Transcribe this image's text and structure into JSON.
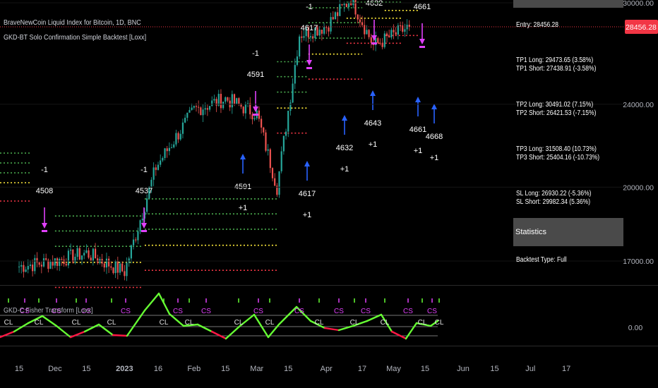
{
  "title": "BraveNewCoin Liquid Index for Bitcoin, 1D, BNC",
  "indicator_title": "GKD-BT Solo Confirmation Simple Backtest [Loxx]",
  "sub_indicator_title": "GKD-C Fisher Transform [Loxx]",
  "colors": {
    "background": "#000000",
    "up_candle": "#26a69a",
    "down_candle": "#ef5350",
    "long_arrow": "#2962ff",
    "short_arrow": "#e040fb",
    "tp_level": "#4caf50",
    "entry_level": "#ffeb3b",
    "sl_level": "#f23645",
    "price_line": "#f23645",
    "price_badge": "#f23645",
    "fisher_up": "#66ff33",
    "fisher_down": "#ff1744",
    "panel_header": "#4a4a4a"
  },
  "panel": {
    "entry": "Entry: 28456.28",
    "tp1_long": "TP1 Long: 29473.65 (3.58%)",
    "tp1_short": "TP1 Short: 27438.91 (-3.58%)",
    "tp2_long": "TP2 Long: 30491.02 (7.15%)",
    "tp2_short": "TP2 Short: 26421.53 (-7.15%)",
    "tp3_long": "TP3 Long: 31508.40 (10.73%)",
    "tp3_short": "TP3 Short: 25404.16 (-10.73%)",
    "sl_long": "SL Long: 26930.22 (-5.36%)",
    "sl_short": "SL Short: 29982.34 (5.36%)",
    "stats_header": "Statistics",
    "backtest_type": "Backtest Type: Full"
  },
  "chart_data": [
    {
      "type": "candlestick",
      "title": "BraveNewCoin Liquid Index for Bitcoin, 1D, BNC",
      "price_scale": "log",
      "y_ticks": [
        "17000.00",
        "20000.00",
        "24000.00",
        "30000.00"
      ],
      "last_price": "28456.28",
      "x_ticks": [
        "15",
        "Dec",
        "15",
        "2023",
        "16",
        "Feb",
        "15",
        "Mar",
        "15",
        "Apr",
        "17",
        "May",
        "15",
        "Jun",
        "15",
        "Jul",
        "17"
      ],
      "approx_close": [
        {
          "date": "2022-11-15",
          "value": 16800
        },
        {
          "date": "2022-12-01",
          "value": 17000
        },
        {
          "date": "2022-12-15",
          "value": 17300
        },
        {
          "date": "2023-01-01",
          "value": 16600
        },
        {
          "date": "2023-01-15",
          "value": 20900
        },
        {
          "date": "2023-02-01",
          "value": 23700
        },
        {
          "date": "2023-02-15",
          "value": 24300
        },
        {
          "date": "2023-03-01",
          "value": 23500
        },
        {
          "date": "2023-03-10",
          "value": 20000
        },
        {
          "date": "2023-03-20",
          "value": 28000
        },
        {
          "date": "2023-04-01",
          "value": 28500
        },
        {
          "date": "2023-04-12",
          "value": 30300
        },
        {
          "date": "2023-04-22",
          "value": 27300
        },
        {
          "date": "2023-05-08",
          "value": 28456
        }
      ],
      "trade_annotations": [
        {
          "side": "short",
          "labels": [
            "-1",
            "4508"
          ]
        },
        {
          "side": "short",
          "labels": [
            "-1",
            "4537"
          ]
        },
        {
          "side": "short",
          "labels": [
            "-1",
            "4591"
          ]
        },
        {
          "side": "short",
          "labels": [
            "-1",
            "4617"
          ]
        },
        {
          "side": "short",
          "labels": [
            "4632"
          ]
        },
        {
          "side": "short",
          "labels": [
            "4661"
          ]
        },
        {
          "side": "long",
          "labels": [
            "4591",
            "+1"
          ]
        },
        {
          "side": "long",
          "labels": [
            "4617",
            "+1"
          ]
        },
        {
          "side": "long",
          "labels": [
            "4632",
            "+1"
          ]
        },
        {
          "side": "long",
          "labels": [
            "4643",
            "+1"
          ]
        },
        {
          "side": "long",
          "labels": [
            "4661",
            "+1"
          ]
        },
        {
          "side": "long",
          "labels": [
            "4668",
            "+1"
          ]
        }
      ]
    },
    {
      "type": "line",
      "title": "GKD-C Fisher Transform [Loxx]",
      "y_ticks": [
        "0.00"
      ],
      "signal_labels": [
        "CL",
        "CS"
      ]
    }
  ]
}
